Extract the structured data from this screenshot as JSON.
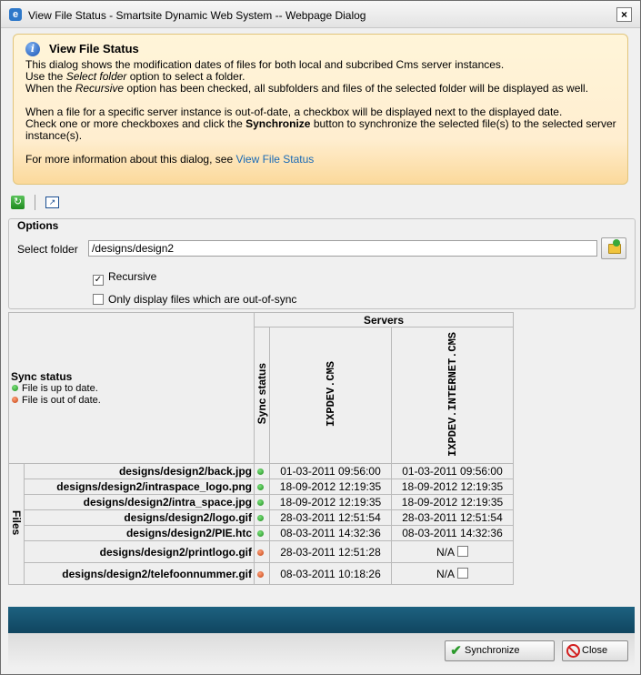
{
  "window": {
    "title": "View File Status - Smartsite Dynamic Web System -- Webpage Dialog",
    "icon": "ie-icon",
    "close_glyph": "×"
  },
  "info": {
    "title": "View File Status",
    "line1": "This dialog shows the modification dates of files for both local and subcribed Cms server instances.",
    "line2_pre": "Use the ",
    "line2_em": "Select folder",
    "line2_post": " option to select a folder.",
    "line3_pre": "When the ",
    "line3_em": "Recursive",
    "line3_post": " option has been checked, all subfolders and files of the selected folder will be displayed as well.",
    "line4": "When a file for a specific server instance is out-of-date, a checkbox will be displayed next to the displayed date.",
    "line5_pre": "Check one or more checkboxes and click the ",
    "line5_strong": "Synchronize",
    "line5_post": " button to synchronize the selected file(s) to the selected server instance(s).",
    "line6_pre": "For more information about this dialog, see ",
    "line6_link": "View File Status"
  },
  "options": {
    "legend": "Options",
    "folder_label": "Select folder",
    "folder_value": "/designs/design2",
    "recursive_label": "Recursive",
    "recursive_checked": true,
    "outofsync_label": "Only display files which are out-of-sync",
    "outofsync_checked": false
  },
  "grid": {
    "servers_header": "Servers",
    "sync_status_header": "Sync status",
    "legend_title": "Sync status",
    "legend_up": "File is up to date.",
    "legend_out": "File is out of date.",
    "files_header": "Files",
    "servers": [
      "IXPDEV.CMS",
      "IXPDEV.INTERNET.CMS"
    ],
    "rows": [
      {
        "file": "designs/design2/back.jpg",
        "status": "green",
        "d1": "01-03-2011 09:56:00",
        "d2": "01-03-2011 09:56:00"
      },
      {
        "file": "designs/design2/intraspace_logo.png",
        "status": "green",
        "d1": "18-09-2012 12:19:35",
        "d2": "18-09-2012 12:19:35"
      },
      {
        "file": "designs/design2/intra_space.jpg",
        "status": "green",
        "d1": "18-09-2012 12:19:35",
        "d2": "18-09-2012 12:19:35"
      },
      {
        "file": "designs/design2/logo.gif",
        "status": "green",
        "d1": "28-03-2011 12:51:54",
        "d2": "28-03-2011 12:51:54"
      },
      {
        "file": "designs/design2/PIE.htc",
        "status": "green",
        "d1": "08-03-2011 14:32:36",
        "d2": "08-03-2011 14:32:36"
      },
      {
        "file": "designs/design2/printlogo.gif",
        "status": "red",
        "d1": "28-03-2011 12:51:28",
        "d2": "N/A"
      },
      {
        "file": "designs/design2/telefoonnummer.gif",
        "status": "red",
        "d1": "08-03-2011 10:18:26",
        "d2": "N/A"
      }
    ]
  },
  "buttons": {
    "synchronize": "Synchronize",
    "close": "Close"
  }
}
